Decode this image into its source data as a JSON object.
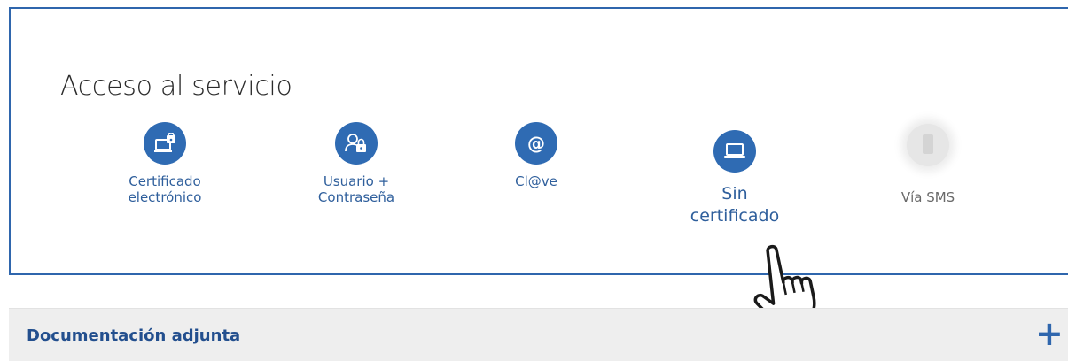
{
  "access": {
    "title": "Acceso al servicio",
    "options": [
      {
        "icon": "laptop-lock-icon",
        "label": "Certificado\nelectrónico"
      },
      {
        "icon": "user-lock-icon",
        "label": "Usuario +\nContraseña"
      },
      {
        "icon": "at-sign-icon",
        "label": "Cl@ve",
        "symbol": "@"
      },
      {
        "icon": "laptop-icon",
        "label": "Sin\ncertificado"
      },
      {
        "icon": "phone-icon",
        "label": "Vía SMS"
      }
    ]
  },
  "documentation": {
    "title": "Documentación adjunta",
    "expand_symbol": "+"
  },
  "colors": {
    "accent": "#2f6bb3",
    "border": "#2f66ad",
    "label": "#2f5f9c",
    "bar_background": "#eeeeee"
  }
}
